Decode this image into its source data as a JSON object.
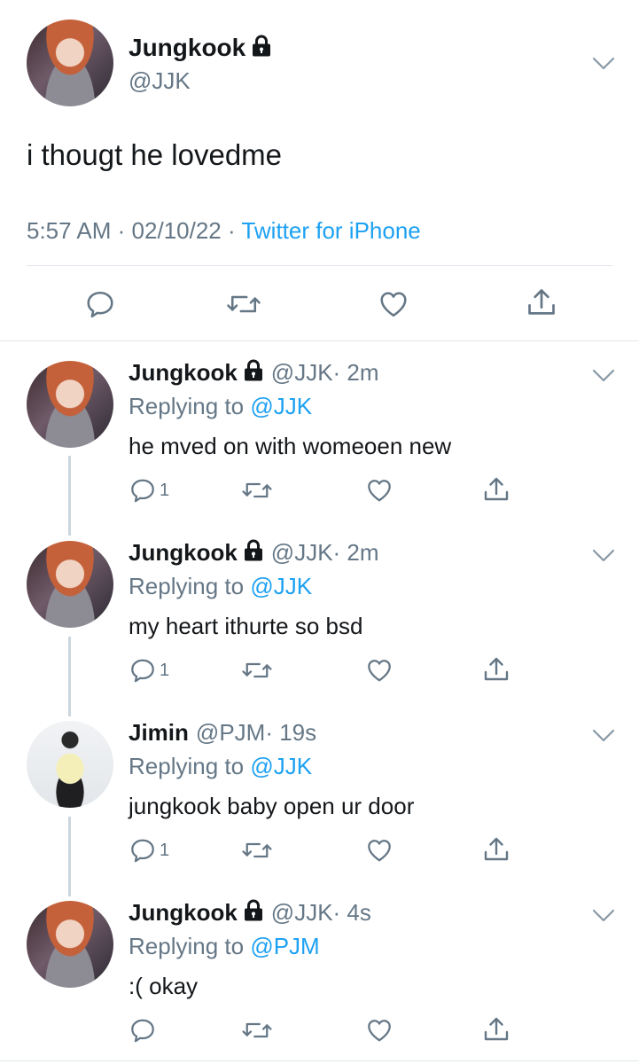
{
  "main_tweet": {
    "name": "Jungkook",
    "handle": "@JJK",
    "text": "i thougt he lovedme",
    "time": "5:57 AM",
    "date": "02/10/22",
    "separator": "·",
    "source": "Twitter for iPhone"
  },
  "replies": [
    {
      "name": "Jungkook",
      "handle": "@JJK",
      "age": "· 2m",
      "replying_prefix": "Replying to",
      "replying_to": "@JJK",
      "text": "he mved on with womeoen new",
      "reply_count": "1",
      "locked": true
    },
    {
      "name": "Jungkook",
      "handle": "@JJK",
      "age": "· 2m",
      "replying_prefix": "Replying to",
      "replying_to": "@JJK",
      "text": "my heart ithurte so bsd",
      "reply_count": "1",
      "locked": true
    },
    {
      "name": "Jimin",
      "handle": "@PJM",
      "age": "· 19s",
      "replying_prefix": "Replying to",
      "replying_to": "@JJK",
      "text": "jungkook baby open ur door",
      "reply_count": "1",
      "locked": false
    },
    {
      "name": "Jungkook",
      "handle": "@JJK",
      "age": "· 4s",
      "replying_prefix": "Replying to",
      "replying_to": "@PJM",
      "text": ":( okay",
      "reply_count": "",
      "locked": true
    }
  ],
  "colors": {
    "accent": "#1da1f2",
    "muted": "#657786",
    "text": "#14171a",
    "divider": "#e1e8ed"
  },
  "icons": [
    "lock-icon",
    "chevron-down-icon",
    "reply-icon",
    "retweet-icon",
    "like-icon",
    "share-icon"
  ]
}
